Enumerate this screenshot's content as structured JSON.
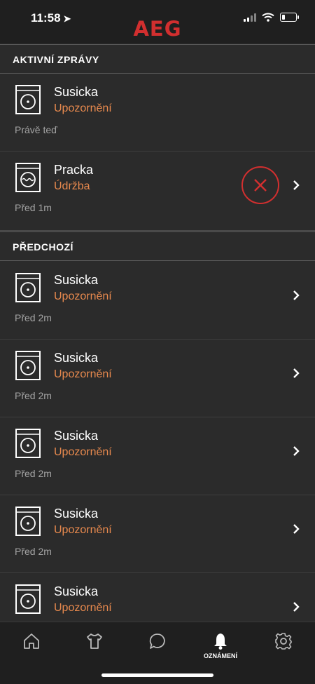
{
  "status_bar": {
    "time": "11:58",
    "location_arrow": "location-arrow-icon"
  },
  "brand": {
    "logo_text": "AEG",
    "color": "#d22f2f"
  },
  "colors": {
    "background": "#2b2b2b",
    "bar": "#1f1f1f",
    "accent": "#e98a4e",
    "delete": "#d22f2f"
  },
  "sections": {
    "active": {
      "title": "AKTIVNÍ ZPRÁVY"
    },
    "previous": {
      "title": "PŘEDCHOZÍ"
    }
  },
  "active_items": [
    {
      "name": "Susicka",
      "type": "Upozornění",
      "time": "Právě teď",
      "icon": "dryer-icon"
    },
    {
      "name": "Pracka",
      "type": "Údržba",
      "time": "Před 1m",
      "icon": "washer-icon"
    }
  ],
  "previous_items": [
    {
      "name": "Susicka",
      "type": "Upozornění",
      "time": "Před 2m",
      "icon": "dryer-icon"
    },
    {
      "name": "Susicka",
      "type": "Upozornění",
      "time": "Před 2m",
      "icon": "dryer-icon"
    },
    {
      "name": "Susicka",
      "type": "Upozornění",
      "time": "Před 2m",
      "icon": "dryer-icon"
    },
    {
      "name": "Susicka",
      "type": "Upozornění",
      "time": "Před 2m",
      "icon": "dryer-icon"
    },
    {
      "name": "Susicka",
      "type": "Upozornění",
      "time": "",
      "icon": "dryer-icon"
    }
  ],
  "tab_bar": {
    "tabs": [
      {
        "icon": "home-icon",
        "label": ""
      },
      {
        "icon": "shirt-icon",
        "label": ""
      },
      {
        "icon": "chat-bubble-icon",
        "label": ""
      },
      {
        "icon": "bell-icon",
        "label": "OZNÁMENÍ",
        "active": true
      },
      {
        "icon": "gear-icon",
        "label": ""
      }
    ]
  }
}
